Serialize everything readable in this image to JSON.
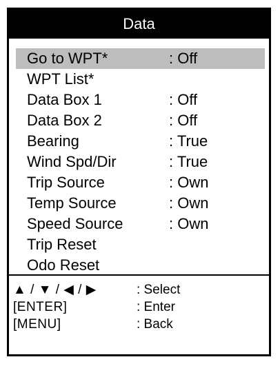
{
  "menu": {
    "title": "Data",
    "items": [
      {
        "label": "Go to WPT*",
        "value": ": Off",
        "selected": true
      },
      {
        "label": "WPT List*",
        "value": ""
      },
      {
        "label": "Data Box 1",
        "value": ": Off"
      },
      {
        "label": "Data Box 2",
        "value": ": Off"
      },
      {
        "label": "Bearing",
        "value": ": True"
      },
      {
        "label": "Wind Spd/Dir",
        "value": ": True"
      },
      {
        "label": "Trip Source",
        "value": ": Own"
      },
      {
        "label": "Temp Source",
        "value": ": Own"
      },
      {
        "label": "Speed Source",
        "value": ": Own"
      },
      {
        "label": "Trip Reset",
        "value": ""
      },
      {
        "label": "Odo Reset",
        "value": ""
      }
    ]
  },
  "help": [
    {
      "key": "▲ / ▼ / ◀ / ▶",
      "action": ": Select"
    },
    {
      "key": "[ENTER]",
      "action": ": Enter"
    },
    {
      "key": "[MENU]",
      "action": ": Back"
    }
  ],
  "colors": {
    "title_bg": "#000000",
    "title_text": "#ffffff",
    "highlight": "#bdbdbd",
    "border": "#000000"
  }
}
